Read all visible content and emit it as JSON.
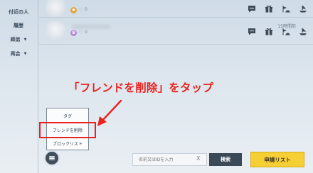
{
  "sidebar": {
    "items": [
      {
        "label": "付近の人",
        "has_chevron": false
      },
      {
        "label": "履歴",
        "has_chevron": false
      },
      {
        "label": "師弟",
        "has_chevron": true
      },
      {
        "label": "再会",
        "has_chevron": true
      }
    ]
  },
  "friends": [
    {
      "heart_count": "0",
      "time": "",
      "badge_icon": "star-badge-icon"
    },
    {
      "heart_count": "0",
      "time": "15時間前",
      "badge_icon": "crown-badge-icon"
    }
  ],
  "context_menu": {
    "items": [
      "タグ",
      "フレンドを削除",
      "ブロックリスト"
    ]
  },
  "annotation": {
    "callout": "「フレンドを削除」をタップ"
  },
  "bottom_bar": {
    "search_placeholder": "名前又はIDを入力",
    "clear_label": "X",
    "search_button": "検索",
    "request_button": "申請リスト"
  },
  "colors": {
    "annotation_red": "#e8231f",
    "request_yellow": "#f5cf33",
    "dark_button": "#3c4a58"
  }
}
